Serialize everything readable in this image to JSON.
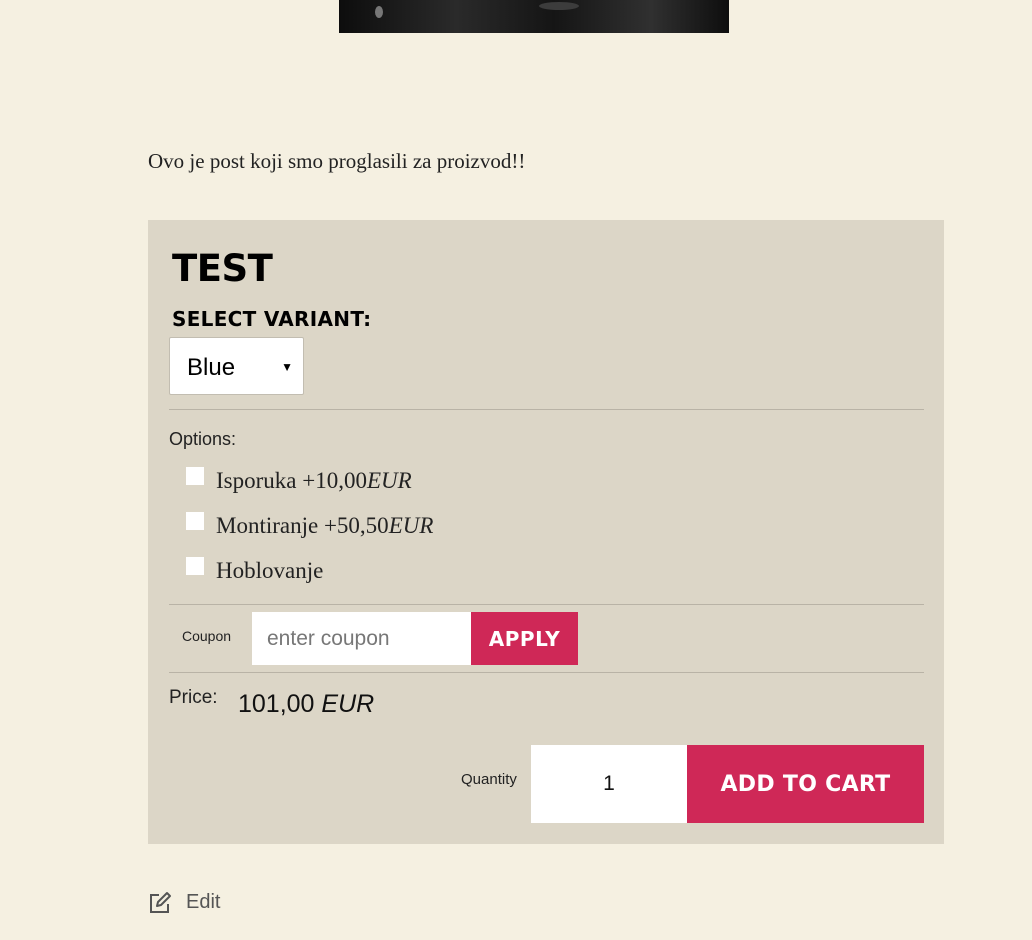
{
  "post": {
    "text": "Ovo je post koji smo proglasili za proizvod!!"
  },
  "product": {
    "title": "TEST",
    "variant_label": "SELECT VARIANT:",
    "variant_selected": "Blue",
    "options_label": "Options:",
    "options": [
      {
        "name": "Isporuka",
        "price": "+10,00",
        "currency": "EUR"
      },
      {
        "name": "Montiranje",
        "price": "+50,50",
        "currency": "EUR"
      },
      {
        "name": "Hoblovanje",
        "price": "",
        "currency": ""
      }
    ],
    "coupon_label": "Coupon",
    "coupon_placeholder": "enter coupon",
    "apply_label": "APPLY",
    "price_label": "Price:",
    "price_value": "101,00",
    "price_currency": "EUR",
    "quantity_label": "Quantity",
    "quantity_value": "1",
    "add_to_cart_label": "ADD TO CART"
  },
  "footer": {
    "edit_label": "Edit"
  },
  "colors": {
    "page_background": "#f5f0e1",
    "box_background": "#dcd6c7",
    "accent": "#cf2857"
  }
}
